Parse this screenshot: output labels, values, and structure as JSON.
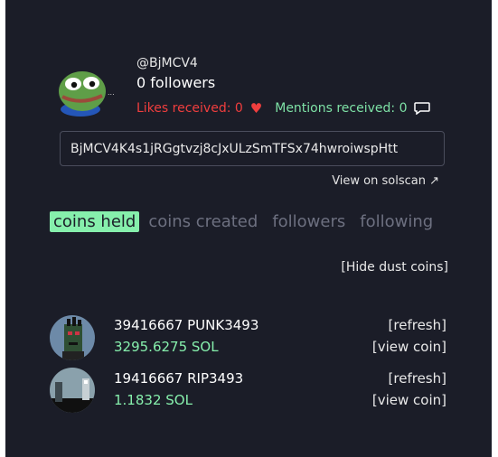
{
  "profile": {
    "handle": "@BjMCV4",
    "followers_text": "0 followers",
    "likes_text": "Likes received: 0",
    "mentions_text": "Mentions received: 0",
    "address": "BjMCV4K4s1jRGgtvzj8cJxULzSmTFSx74hwroiwspHtt",
    "view_solscan": "View on solscan ↗"
  },
  "tabs": [
    {
      "label": "coins held",
      "active": true
    },
    {
      "label": "coins created",
      "active": false
    },
    {
      "label": "followers",
      "active": false
    },
    {
      "label": "following",
      "active": false
    }
  ],
  "hide_dust": "[Hide dust coins]",
  "coins": [
    {
      "name": "39416667 PUNK3493",
      "sol": "3295.6275 SOL",
      "refresh": "[refresh]",
      "view": "[view coin]"
    },
    {
      "name": "19416667 RIP3493",
      "sol": "1.1832 SOL",
      "refresh": "[refresh]",
      "view": "[view coin]"
    }
  ],
  "colors": {
    "background": "#1b1d28",
    "accent_green": "#86efac",
    "likes_red": "#f03e3e",
    "mentions_green": "#7ee2a6"
  }
}
